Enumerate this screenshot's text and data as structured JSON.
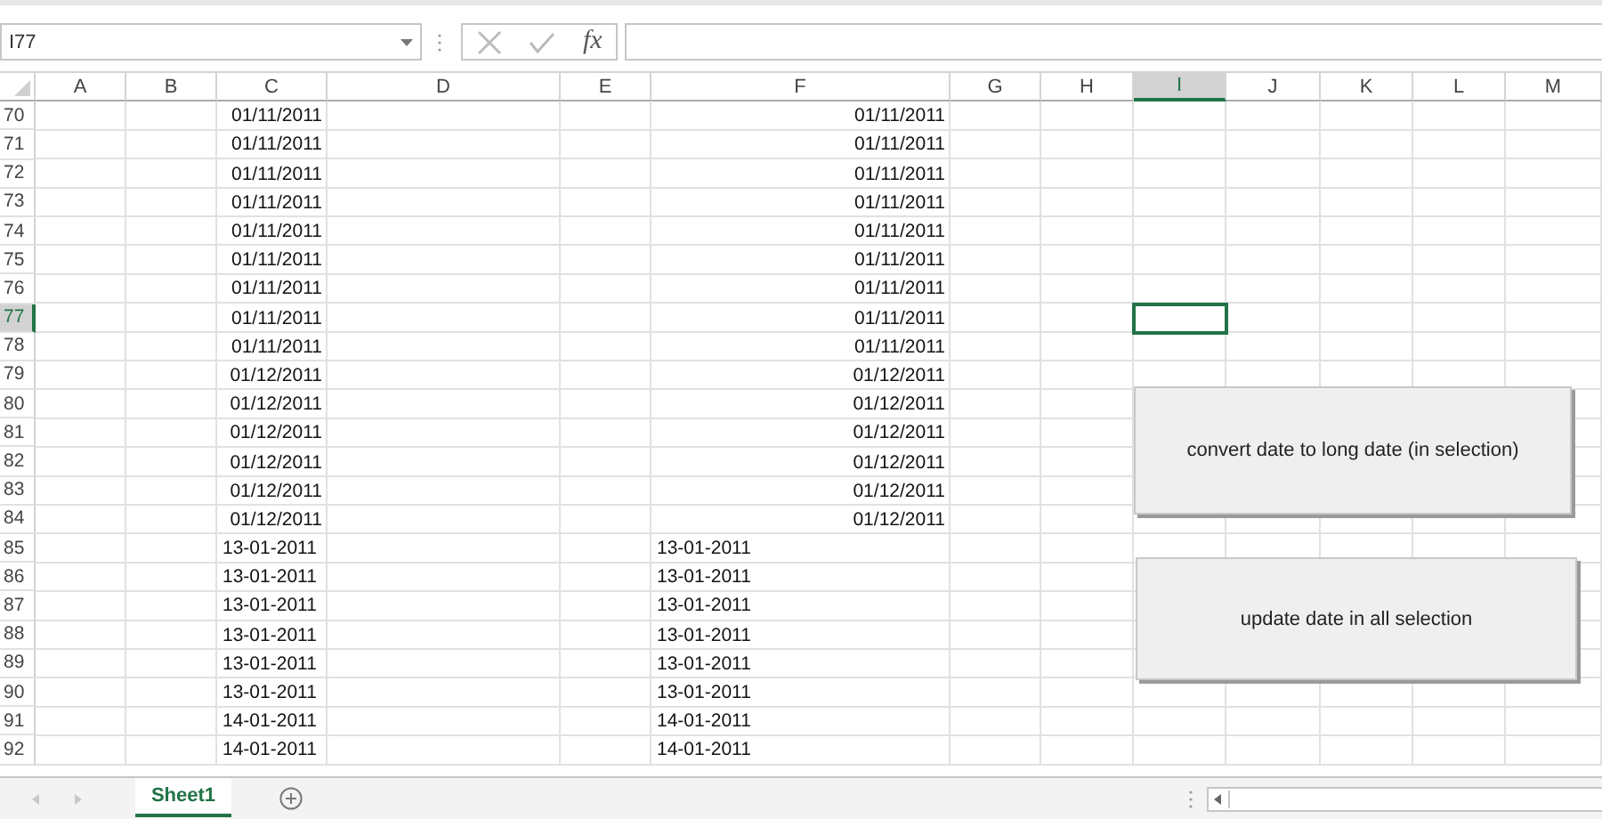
{
  "name_box": {
    "value": "I77"
  },
  "formula_bar": {
    "function_label": "fx"
  },
  "columns": [
    {
      "label": "A",
      "selected": false
    },
    {
      "label": "B",
      "selected": false
    },
    {
      "label": "C",
      "selected": false
    },
    {
      "label": "D",
      "selected": false
    },
    {
      "label": "E",
      "selected": false
    },
    {
      "label": "F",
      "selected": false
    },
    {
      "label": "G",
      "selected": false
    },
    {
      "label": "H",
      "selected": false
    },
    {
      "label": "I",
      "selected": true
    },
    {
      "label": "J",
      "selected": false
    },
    {
      "label": "K",
      "selected": false
    },
    {
      "label": "L",
      "selected": false
    },
    {
      "label": "M",
      "selected": false
    }
  ],
  "rows": [
    {
      "number": "70",
      "selected": false,
      "kind": "date",
      "c": "01/11/2011",
      "f": "01/11/2011"
    },
    {
      "number": "71",
      "selected": false,
      "kind": "date",
      "c": "01/11/2011",
      "f": "01/11/2011"
    },
    {
      "number": "72",
      "selected": false,
      "kind": "date",
      "c": "01/11/2011",
      "f": "01/11/2011"
    },
    {
      "number": "73",
      "selected": false,
      "kind": "date",
      "c": "01/11/2011",
      "f": "01/11/2011"
    },
    {
      "number": "74",
      "selected": false,
      "kind": "date",
      "c": "01/11/2011",
      "f": "01/11/2011"
    },
    {
      "number": "75",
      "selected": false,
      "kind": "date",
      "c": "01/11/2011",
      "f": "01/11/2011"
    },
    {
      "number": "76",
      "selected": false,
      "kind": "date",
      "c": "01/11/2011",
      "f": "01/11/2011"
    },
    {
      "number": "77",
      "selected": true,
      "kind": "date",
      "c": "01/11/2011",
      "f": "01/11/2011"
    },
    {
      "number": "78",
      "selected": false,
      "kind": "date",
      "c": "01/11/2011",
      "f": "01/11/2011"
    },
    {
      "number": "79",
      "selected": false,
      "kind": "date",
      "c": "01/12/2011",
      "f": "01/12/2011"
    },
    {
      "number": "80",
      "selected": false,
      "kind": "date",
      "c": "01/12/2011",
      "f": "01/12/2011"
    },
    {
      "number": "81",
      "selected": false,
      "kind": "date",
      "c": "01/12/2011",
      "f": "01/12/2011"
    },
    {
      "number": "82",
      "selected": false,
      "kind": "date",
      "c": "01/12/2011",
      "f": "01/12/2011"
    },
    {
      "number": "83",
      "selected": false,
      "kind": "date",
      "c": "01/12/2011",
      "f": "01/12/2011"
    },
    {
      "number": "84",
      "selected": false,
      "kind": "date",
      "c": "01/12/2011",
      "f": "01/12/2011"
    },
    {
      "number": "85",
      "selected": false,
      "kind": "text",
      "c": "13-01-2011",
      "f": "13-01-2011"
    },
    {
      "number": "86",
      "selected": false,
      "kind": "text",
      "c": "13-01-2011",
      "f": "13-01-2011"
    },
    {
      "number": "87",
      "selected": false,
      "kind": "text",
      "c": "13-01-2011",
      "f": "13-01-2011"
    },
    {
      "number": "88",
      "selected": false,
      "kind": "text",
      "c": "13-01-2011",
      "f": "13-01-2011"
    },
    {
      "number": "89",
      "selected": false,
      "kind": "text",
      "c": "13-01-2011",
      "f": "13-01-2011"
    },
    {
      "number": "90",
      "selected": false,
      "kind": "text",
      "c": "13-01-2011",
      "f": "13-01-2011"
    },
    {
      "number": "91",
      "selected": false,
      "kind": "text",
      "c": "14-01-2011",
      "f": "14-01-2011"
    },
    {
      "number": "92",
      "selected": false,
      "kind": "text",
      "c": "14-01-2011",
      "f": "14-01-2011"
    }
  ],
  "buttons": [
    {
      "label": "convert date to long date (in selection)"
    },
    {
      "label": "update date in all selection"
    }
  ],
  "sheet_tabs": [
    {
      "label": "Sheet1",
      "selected": true
    }
  ]
}
